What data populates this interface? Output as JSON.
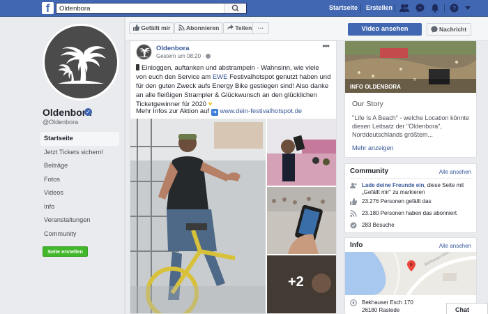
{
  "topbar": {
    "search_value": "Oldenbora",
    "links": [
      "Startseite",
      "Erstellen"
    ],
    "brand_color": "#4267b2"
  },
  "page": {
    "name": "Oldenbora",
    "handle": "@Oldenbora",
    "nav": [
      "Startseite",
      "Jetzt Tickets sichern!",
      "Beiträge",
      "Fotos",
      "Videos",
      "Info",
      "Veranstaltungen",
      "Community"
    ],
    "create_page_label": "Seite erstellen"
  },
  "actions": {
    "like": "Gefällt mir",
    "follow": "Abonnieren",
    "share": "Teilen",
    "more": "···",
    "watch_video": "Video ansehen",
    "message": "Nachricht"
  },
  "post": {
    "author": "Oldenbora",
    "time": "Gestern um 08:20 · ",
    "text_before": "Einloggen, auftanken und abstrampeln - Wahnsinn, wie viele von euch den Service am ",
    "text_link": "EWE",
    "text_after": " Festivalhotspot genutzt haben und für den guten Zweck aufs Energy Bike gestiegen sind! Also danke an alle fleißigen Strampler & Glückwunsch an den glücklichen Ticketgewinner für 2020 ",
    "more_info_label": "Mehr Infos zur Aktion auf ",
    "more_info_link": "www.dein-festivalhotspot.de",
    "more_photos": "+2"
  },
  "story": {
    "cover_label": "INFO OLDENBORA",
    "title": "Our Story",
    "text": "\"Life Is A Beach\" - welche Location könnte diesen Leitsatz der \"Oldenbora\", Norddeutschlands größtem...",
    "more": "Mehr anzeigen"
  },
  "community": {
    "title": "Community",
    "see_all": "Alle ansehen",
    "invite_link": "Lade deine Freunde ein",
    "invite_rest": ", diese Seite mit „Gefällt mir\" zu markieren",
    "likes": "23.276 Personen gefällt das",
    "follows": "23.180 Personen haben das abonniert",
    "visits": "283 Besuche"
  },
  "info": {
    "title": "Info",
    "see_all": "Alle ansehen",
    "map_street_label": "Bekhauser Esch",
    "address_line1": "Bekhauser Esch 170",
    "address_line2": "26180 Rastede"
  },
  "chat": {
    "label": "Chat"
  }
}
